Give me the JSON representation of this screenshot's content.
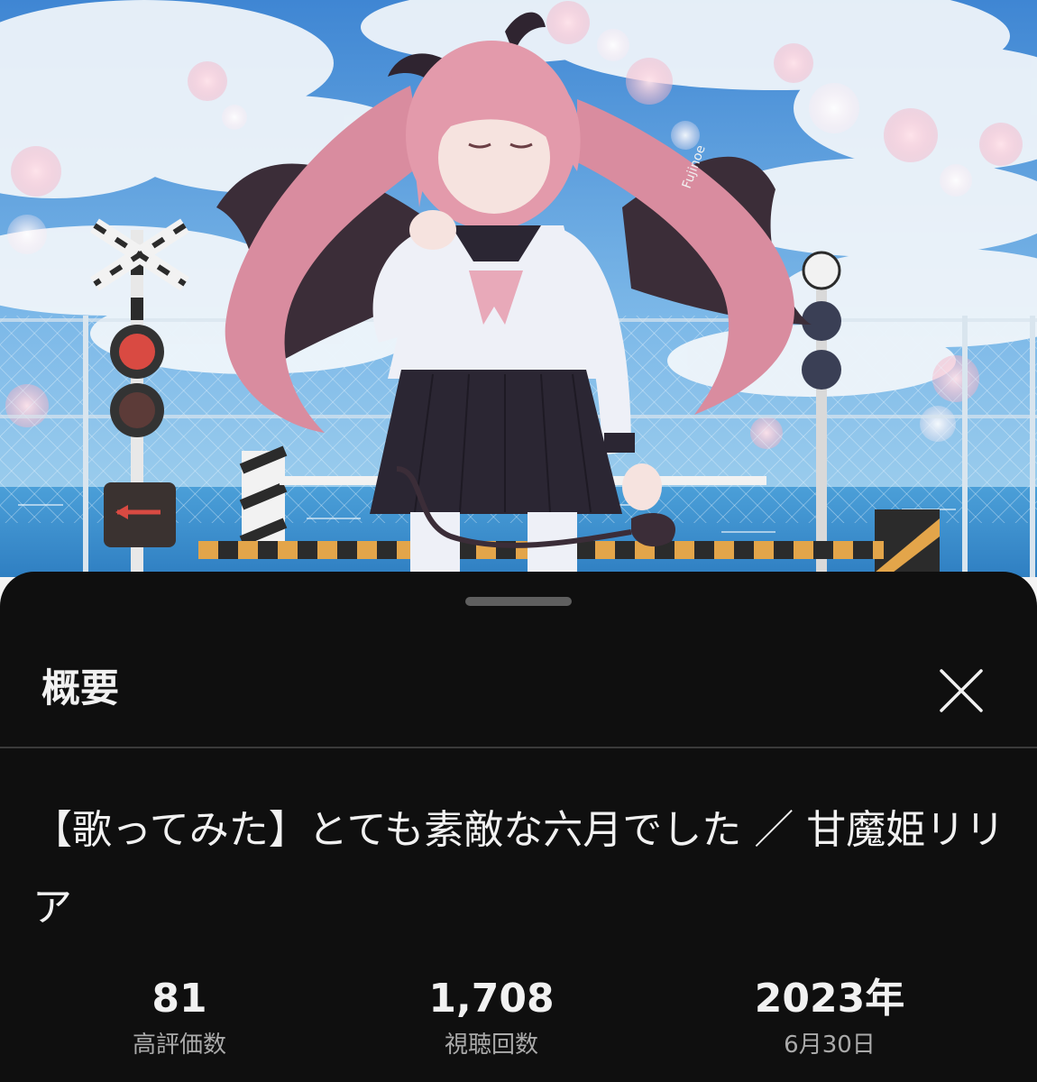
{
  "thumbnail": {
    "signature": "Fujinoe",
    "sky_color": "#5fa3dd",
    "hair_color": "#dc8e9f",
    "uniform_color": "#2b2633"
  },
  "description_panel": {
    "header_title": "概要",
    "close_icon": "close-icon",
    "video_title": "【歌ってみた】とても素敵な六月でした ／ 甘魔姫リリア",
    "stats": {
      "likes": {
        "value": "81",
        "label": "高評価数"
      },
      "views": {
        "value": "1,708",
        "label": "視聴回数"
      },
      "date": {
        "value": "2023年",
        "label": "6月30日"
      }
    }
  }
}
